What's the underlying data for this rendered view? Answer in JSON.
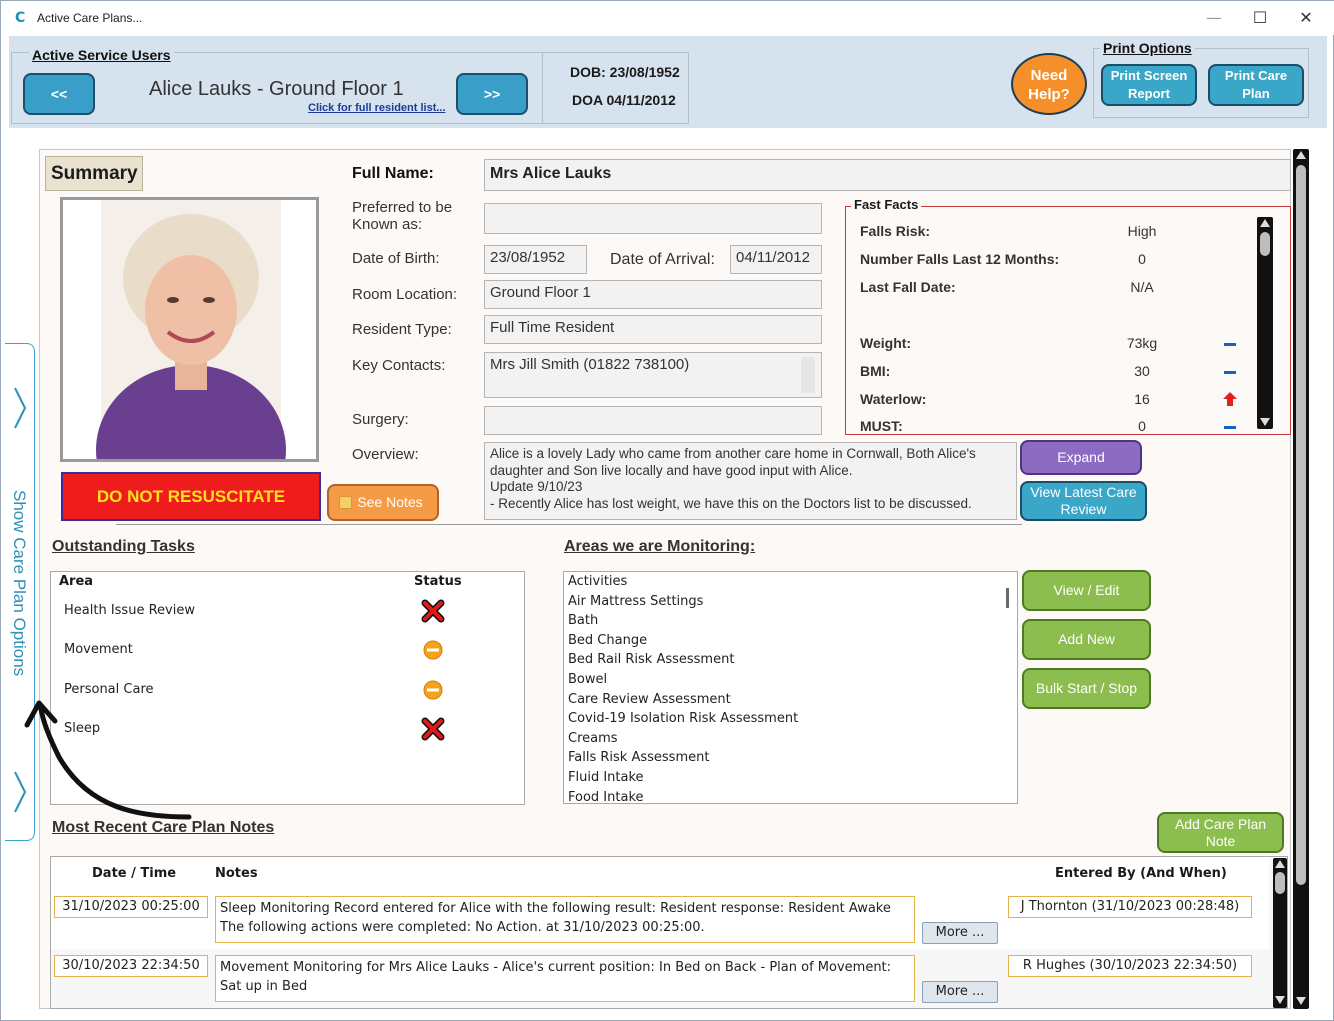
{
  "window": {
    "app_logo": "C",
    "title": "Active Care Plans...",
    "controls": {
      "minimize": "—",
      "maximize": "☐",
      "close": "✕"
    }
  },
  "header": {
    "active_users_label": "Active Service Users",
    "prev_button": "<<",
    "next_button": ">>",
    "resident_title": "Alice Lauks - Ground Floor 1",
    "full_list_link": "Click for full resident list...",
    "dob": "DOB: 23/08/1952",
    "doa": "DOA 04/11/2012",
    "help_button": "Need Help?",
    "print_options_label": "Print Options",
    "print_screen_button": "Print Screen Report",
    "print_care_plan_button": "Print Care Plan"
  },
  "side_tab": {
    "label": "Show Care Plan Options"
  },
  "summary": {
    "tab_label": "Summary",
    "dnr_banner": "DO NOT RESUSCITATE",
    "see_notes_button": "See Notes",
    "full_name_label": "Full Name:",
    "full_name": "Mrs Alice Lauks",
    "preferred_label": "Preferred to be Known as:",
    "preferred": "",
    "dob_label": "Date of Birth:",
    "dob": "23/08/1952",
    "doa_label": "Date of Arrival:",
    "doa": "04/11/2012",
    "room_label": "Room Location:",
    "room": "Ground Floor 1",
    "type_label": "Resident Type:",
    "type": "Full Time Resident",
    "contacts_label": "Key Contacts:",
    "contacts": "Mrs Jill Smith (01822 738100)",
    "surgery_label": "Surgery:",
    "surgery": "",
    "overview_label": "Overview:",
    "overview_lines": [
      "Alice is a lovely Lady who came from another care home in Cornwall, Both Alice's",
      "daughter and Son live locally and have good input with Alice.",
      "Update 9/10/23",
      "- Recently Alice has lost weight, we have this on the Doctors list to be discussed."
    ],
    "expand_button": "Expand",
    "view_review_button": "View Latest Care Review"
  },
  "fast_facts": {
    "title": "Fast Facts",
    "rows": [
      {
        "label": "Falls Risk:",
        "value": "High",
        "trend": ""
      },
      {
        "label": "Number Falls Last 12 Months:",
        "value": "0",
        "trend": ""
      },
      {
        "label": "Last Fall Date:",
        "value": "N/A",
        "trend": ""
      },
      {
        "label": "Weight:",
        "value": "73kg",
        "trend": "flat"
      },
      {
        "label": "BMI:",
        "value": "30",
        "trend": "flat"
      },
      {
        "label": "Waterlow:",
        "value": "16",
        "trend": "up"
      },
      {
        "label": "MUST:",
        "value": "0",
        "trend": "flat"
      }
    ],
    "trend_up_color": "#e0201f",
    "trend_flat_color": "#1565c0"
  },
  "outstanding_tasks": {
    "title": "Outstanding Tasks",
    "col_area": "Area",
    "col_status": "Status",
    "rows": [
      {
        "area": "Health Issue Review",
        "status": "overdue"
      },
      {
        "area": "Movement",
        "status": "due"
      },
      {
        "area": "Personal Care",
        "status": "due"
      },
      {
        "area": "Sleep",
        "status": "overdue"
      }
    ]
  },
  "monitoring": {
    "title": "Areas we are Monitoring:",
    "items": [
      "Activities",
      "Air Mattress Settings",
      "Bath",
      "Bed Change",
      "Bed Rail Risk Assessment",
      "Bowel",
      "Care Review Assessment",
      "Covid-19 Isolation Risk Assessment",
      "Creams",
      "Falls Risk Assessment",
      "Fluid Intake",
      "Food Intake"
    ],
    "view_edit_button": "View / Edit",
    "add_new_button": "Add New",
    "bulk_button": "Bulk Start / Stop"
  },
  "notes": {
    "title": "Most Recent Care Plan Notes",
    "add_button": "Add Care Plan Note",
    "col_datetime": "Date / Time",
    "col_notes": "Notes",
    "col_entered": "Entered By (And When)",
    "rows": [
      {
        "datetime": "31/10/2023 00:25:00",
        "note_line1": "Sleep Monitoring Record entered for Alice with the following result: Resident response: Resident Awake",
        "note_line2": "The following actions were completed:  No Action. at 31/10/2023 00:25:00.",
        "more": "More ...",
        "entered": "J Thornton (31/10/2023 00:28:48)"
      },
      {
        "datetime": "30/10/2023 22:34:50",
        "note_line1": "Movement Monitoring for Mrs Alice Lauks - Alice's current position: In Bed on Back - Plan of Movement:",
        "note_line2": "Sat up in Bed",
        "more": "More ...",
        "entered": "R Hughes (30/10/2023 22:34:50)"
      }
    ]
  }
}
